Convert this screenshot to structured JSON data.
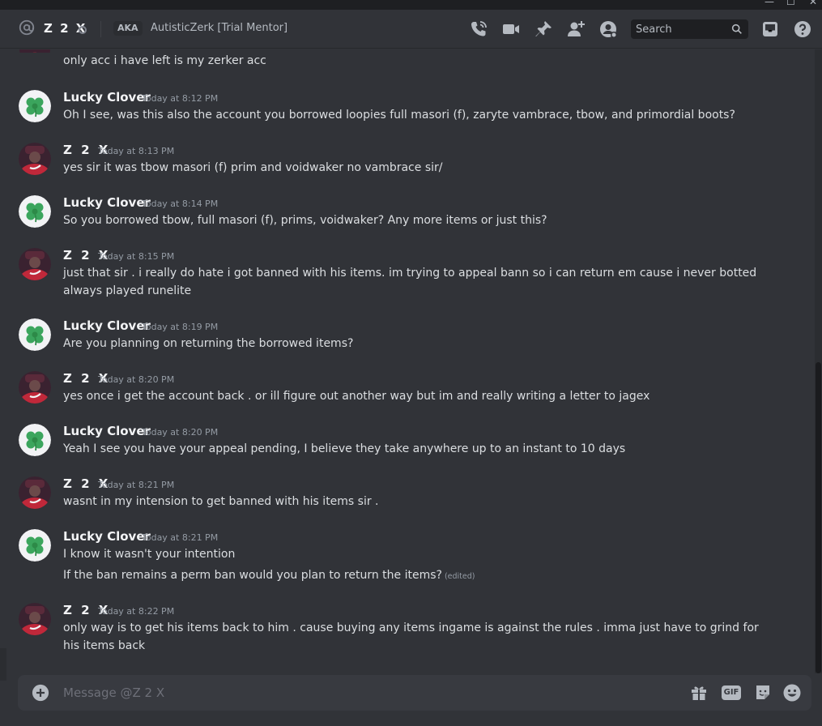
{
  "window": {
    "minimize": "—",
    "maximize": "☐",
    "close": "✕"
  },
  "header": {
    "dm_name": "Z 2 X",
    "aka_label": "AKA",
    "aka_name": "AutisticZerk [Trial Mentor]",
    "search_placeholder": "Search",
    "icons": [
      "call-icon",
      "video-icon",
      "pin-icon",
      "add-friend-icon",
      "user-profile-icon",
      "search-icon",
      "inbox-icon",
      "help-icon"
    ]
  },
  "messages": {
    "previous_line": "only acc i have left is my zerker acc",
    "groups": [
      {
        "author": "Lucky Clover",
        "timestamp": "Today at 8:12 PM",
        "lines": [
          "Oh I see, was this also the account you borrowed loopies full masori (f), zaryte vambrace, tbow, and primordial boots?"
        ]
      },
      {
        "author": "Z 2 X",
        "timestamp": "Today at 8:13 PM",
        "lines": [
          "yes sir it was tbow masori (f) prim and voidwaker no vambrace sir/"
        ]
      },
      {
        "author": "Lucky Clover",
        "timestamp": "Today at 8:14 PM",
        "lines": [
          "So you borrowed tbow, full masori (f), prims, voidwaker? Any more items or just this?"
        ]
      },
      {
        "author": "Z 2 X",
        "timestamp": "Today at 8:15 PM",
        "lines": [
          "just that sir . i really do hate i got banned with his items. im trying to appeal bann so i can return em cause i never botted always played runelite"
        ]
      },
      {
        "author": "Lucky Clover",
        "timestamp": "Today at 8:19 PM",
        "lines": [
          "Are you planning on returning the borrowed items?"
        ]
      },
      {
        "author": "Z 2 X",
        "timestamp": "Today at 8:20 PM",
        "lines": [
          "yes once i get the account back . or ill figure out another way but im and really writing a letter to jagex"
        ]
      },
      {
        "author": "Lucky Clover",
        "timestamp": "Today at 8:20 PM",
        "lines": [
          "Yeah I see you have your appeal pending, I believe they take anywhere up to an instant to 10 days"
        ]
      },
      {
        "author": "Z 2 X",
        "timestamp": "Today at 8:21 PM",
        "lines": [
          "wasnt in my intension to get banned with his items sir ."
        ]
      },
      {
        "author": "Lucky Clover",
        "timestamp": "Today at 8:21 PM",
        "lines": [
          "I know it wasn't your intention",
          "If the ban remains a perm ban would you plan to return the items?"
        ],
        "edited_label": "(edited)"
      },
      {
        "author": "Z 2 X",
        "timestamp": "Today at 8:22 PM",
        "lines": [
          "only way is to get his items back to him . cause buying any items ingame is against the rules . imma just have to grind for his items back"
        ]
      }
    ]
  },
  "composer": {
    "placeholder": "Message @Z 2 X",
    "gif_label": "GIF",
    "icons": [
      "add-attachment-icon",
      "gift-icon",
      "gif-icon",
      "sticker-icon",
      "emoji-icon"
    ]
  },
  "colors": {
    "background": "#313338",
    "header_text": "#f2f3f5",
    "muted_text": "#949ba4",
    "clover_green": "#3ba55d",
    "avatar_red": "#c0283a"
  }
}
